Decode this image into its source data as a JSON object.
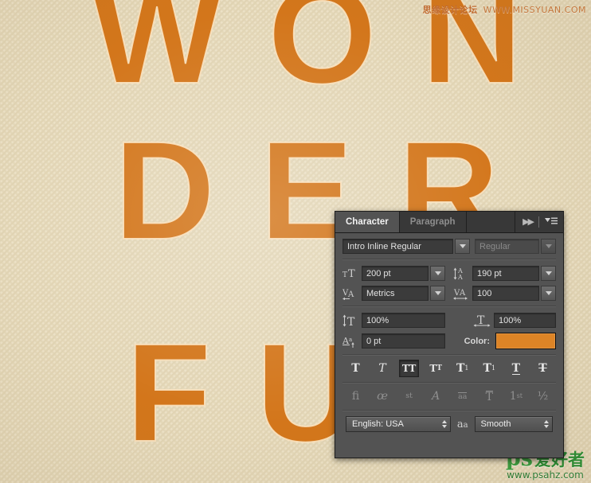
{
  "artwork": {
    "line1": "WON",
    "line2": "DER",
    "line3": "FUL",
    "text_color": "#d3761b",
    "background_color": "#ece1c6"
  },
  "watermarks": {
    "top_cn": "思缘设计论坛",
    "top_url": "WWW.MISSYUAN.COM",
    "bottom_logo_ps": "ps",
    "bottom_logo_cn": "爱好者",
    "bottom_site": "www.psahz.com"
  },
  "panel": {
    "tabs": [
      {
        "label": "Character",
        "active": true
      },
      {
        "label": "Paragraph",
        "active": false
      }
    ],
    "collapse_icon": "double-chevron-right-icon",
    "menu_icon": "panel-menu-icon",
    "font_family": "Intro Inline Regular",
    "font_style": "Regular",
    "font_size_icon": "font-size-icon",
    "font_size": "200 pt",
    "leading_icon": "leading-icon",
    "leading": "190 pt",
    "kerning_icon": "kerning-icon",
    "kerning": "Metrics",
    "tracking_icon": "tracking-icon",
    "tracking": "100",
    "vertical_scale_icon": "vertical-scale-icon",
    "vertical_scale": "100%",
    "horizontal_scale_icon": "horizontal-scale-icon",
    "horizontal_scale": "100%",
    "baseline_shift_icon": "baseline-shift-icon",
    "baseline_shift": "0 pt",
    "color_label": "Color:",
    "color_value": "#dd8426",
    "style_buttons": [
      {
        "name": "faux-bold",
        "glyph": "T",
        "active": false,
        "enabled": true
      },
      {
        "name": "faux-italic",
        "glyph": "T",
        "active": false,
        "enabled": true
      },
      {
        "name": "all-caps",
        "glyph": "TT",
        "active": true,
        "enabled": true
      },
      {
        "name": "small-caps",
        "glyph": "TT",
        "active": false,
        "enabled": true
      },
      {
        "name": "superscript",
        "glyph": "T",
        "active": false,
        "enabled": true
      },
      {
        "name": "subscript",
        "glyph": "T",
        "active": false,
        "enabled": true
      },
      {
        "name": "underline",
        "glyph": "T",
        "active": false,
        "enabled": true
      },
      {
        "name": "strikethrough",
        "glyph": "T",
        "active": false,
        "enabled": true
      }
    ],
    "opentype_buttons": [
      {
        "name": "standard-ligatures",
        "glyph": "fi"
      },
      {
        "name": "contextual-alternates",
        "glyph": "œ"
      },
      {
        "name": "discretionary-ligatures",
        "glyph": "st"
      },
      {
        "name": "swash",
        "glyph": "𝒜"
      },
      {
        "name": "oldstyle",
        "glyph": "aa"
      },
      {
        "name": "titling-alternates",
        "glyph": "T"
      },
      {
        "name": "ordinals",
        "glyph": "1st"
      },
      {
        "name": "fractions",
        "glyph": "½"
      }
    ],
    "language": "English: USA",
    "antialias_icon": "anti-aliasing-icon",
    "antialias": "Smooth"
  }
}
